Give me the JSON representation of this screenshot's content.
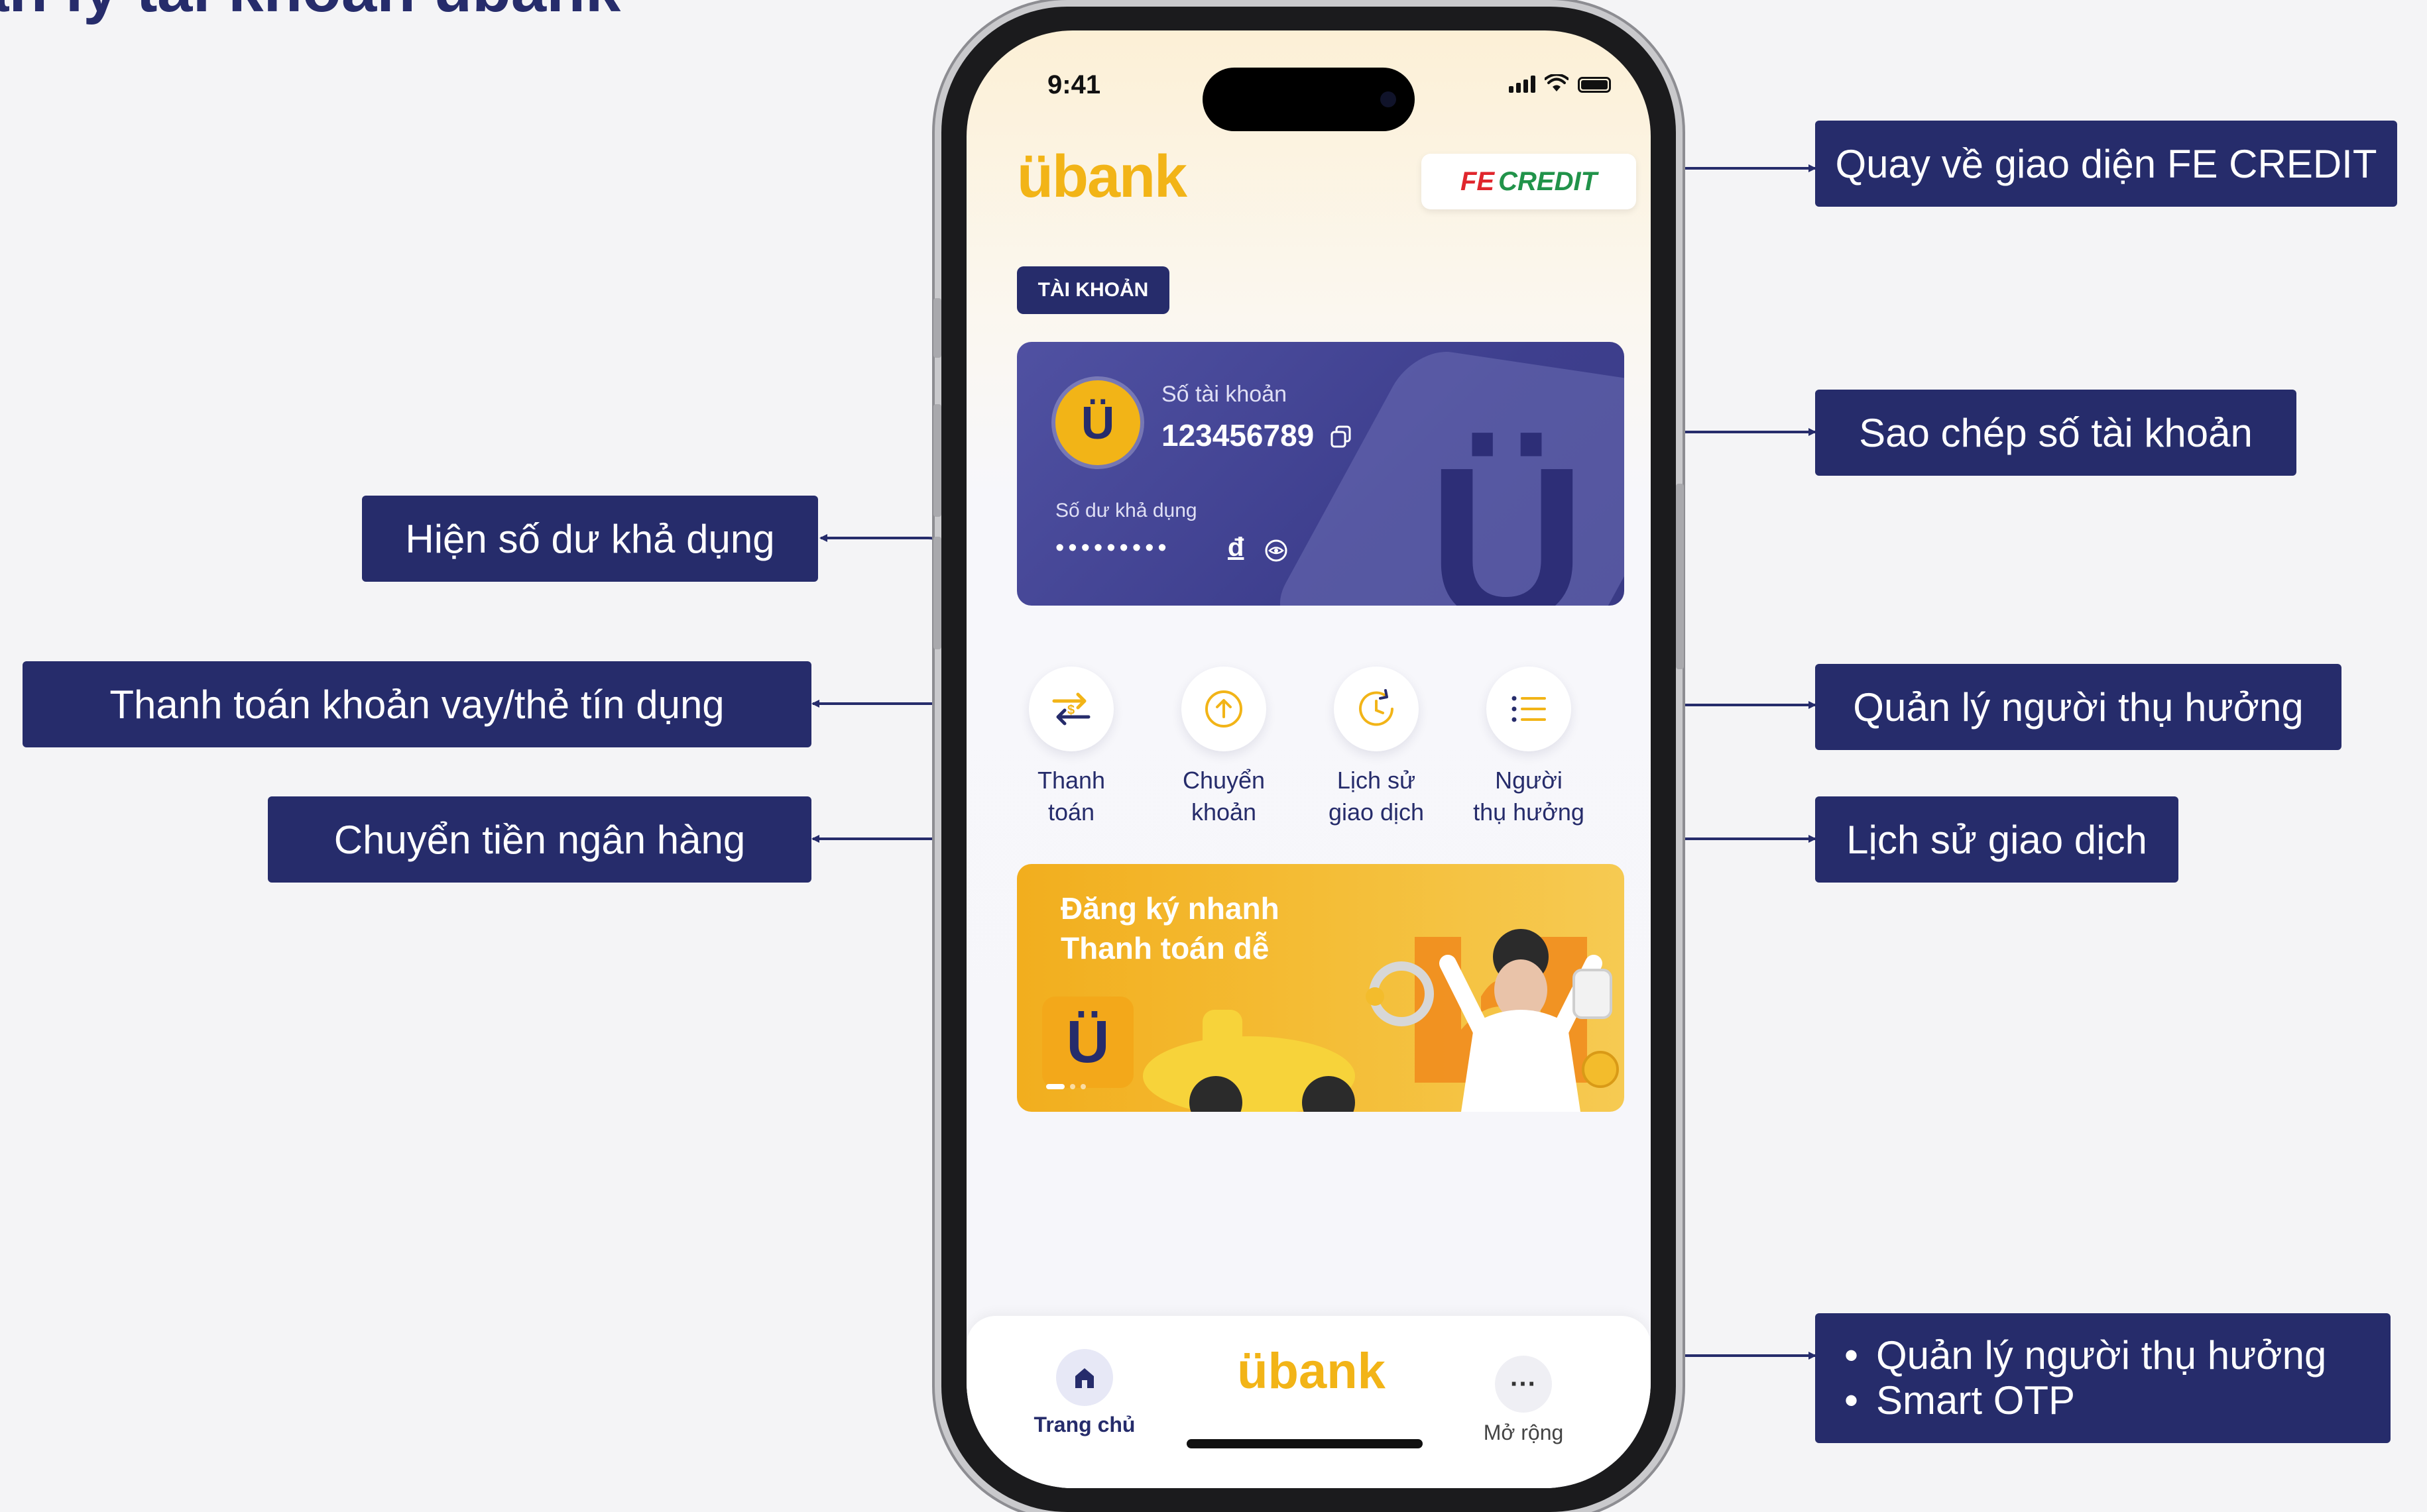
{
  "page_title": "ản lý tài khoản übank",
  "callouts": {
    "fe_credit": "Quay về giao diện FE CREDIT",
    "copy_account": "Sao chép số tài khoản",
    "show_balance": "Hiện số dư khả dụng",
    "pay_loan": "Thanh toán khoản vay/thẻ tín dụng",
    "bank_transfer": "Chuyển tiền ngân hàng",
    "beneficiary": "Quản lý người thụ hưởng",
    "history": "Lịch sử giao dịch",
    "more_items": [
      "Quản lý người thụ hưởng",
      "Smart OTP"
    ]
  },
  "phone": {
    "status": {
      "time": "9:41"
    },
    "header": {
      "logo": "übank",
      "fe_badge": {
        "fe": "FE",
        "credit": "CREDIT"
      }
    },
    "tab_label": "TÀI KHOẢN",
    "account_card": {
      "avatar_letter": "Ü",
      "account_label": "Số tài khoản",
      "account_number": "123456789",
      "balance_label": "Số dư khả dụng",
      "balance_masked": "•••••••••",
      "currency": "đ",
      "icons": [
        "copy-icon",
        "eye-icon"
      ]
    },
    "actions": [
      {
        "label": "Thanh\ntoán",
        "icon": "payment-swap-icon"
      },
      {
        "label": "Chuyển\nkhoản",
        "icon": "transfer-up-icon"
      },
      {
        "label": "Lịch sử\ngiao dịch",
        "icon": "history-clock-icon"
      },
      {
        "label": "Người\nthụ hưởng",
        "icon": "list-icon"
      }
    ],
    "promo": {
      "line1": "Đăng ký nhanh",
      "line2": "Thanh toán dễ",
      "logo_letter": "Ü"
    },
    "bottom_nav": {
      "home": "Trang chủ",
      "logo": "übank",
      "more": "Mở rộng",
      "more_icon": "···"
    }
  },
  "colors": {
    "navy": "#262c6b",
    "gold": "#f2b417",
    "fe_red": "#e0262d",
    "credit_green": "#21934a"
  }
}
